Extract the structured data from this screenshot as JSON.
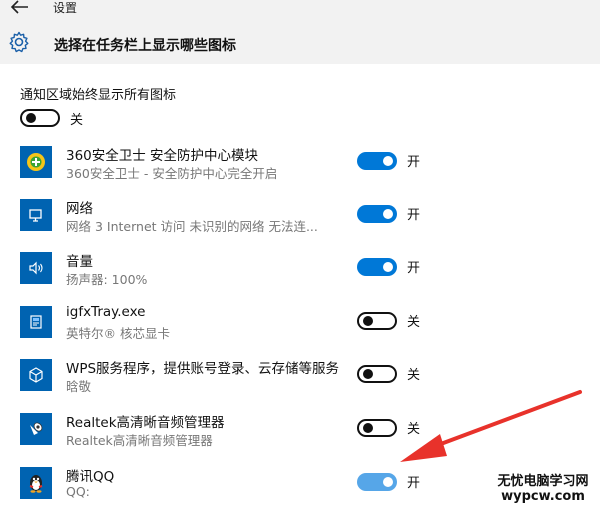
{
  "window": {
    "title": "设置"
  },
  "header": {
    "title": "选择在任务栏上显示哪些图标"
  },
  "always_show": {
    "label": "通知区域始终显示所有图标",
    "state_label": "关"
  },
  "apps": [
    {
      "name": "360安全卫士 安全防护中心模块",
      "desc": "360安全卫士 - 安全防护中心完全开启",
      "state_label": "开",
      "icon": "360-shield-icon"
    },
    {
      "name": "网络",
      "desc": "网络  3 Internet 访问  未识别的网络 无法连...",
      "state_label": "开",
      "icon": "network-icon"
    },
    {
      "name": "音量",
      "desc": "扬声器: 100%",
      "state_label": "开",
      "icon": "speaker-icon"
    },
    {
      "name": "igfxTray.exe",
      "desc": "英特尔® 核芯显卡",
      "state_label": "关",
      "icon": "intel-graphics-icon"
    },
    {
      "name": "WPS服务程序，提供账号登录、云存储等服务",
      "desc": "晗敬",
      "state_label": "关",
      "icon": "wps-cube-icon"
    },
    {
      "name": "Realtek高清晰音频管理器",
      "desc": "Realtek高清晰音频管理器",
      "state_label": "关",
      "icon": "realtek-speaker-icon"
    },
    {
      "name": "腾讯QQ",
      "desc": "QQ:",
      "state_label": "开",
      "icon": "qq-penguin-icon"
    }
  ],
  "watermark": {
    "line1": "无忧电脑学习网",
    "line2": "wypcw.com"
  },
  "colors": {
    "toggle_on": "#0078d7",
    "header_bg": "#f2f2f2",
    "icon_bg": "#0063b1",
    "arrow": "#e8322b"
  }
}
